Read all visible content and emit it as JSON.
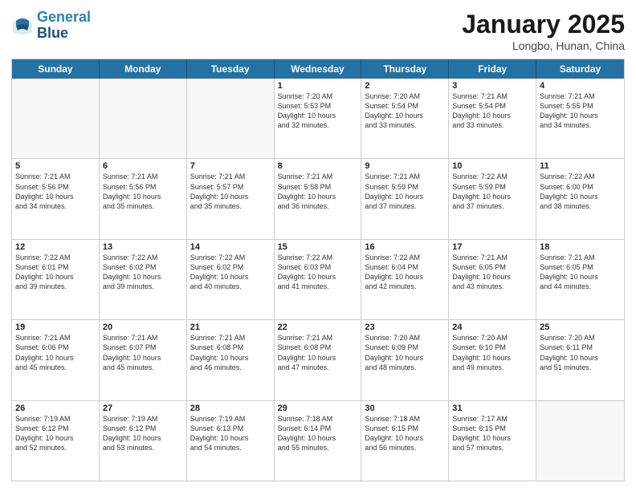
{
  "logo": {
    "line1": "General",
    "line2": "Blue"
  },
  "title": "January 2025",
  "subtitle": "Longbo, Hunan, China",
  "header_days": [
    "Sunday",
    "Monday",
    "Tuesday",
    "Wednesday",
    "Thursday",
    "Friday",
    "Saturday"
  ],
  "weeks": [
    [
      {
        "day": "",
        "info": ""
      },
      {
        "day": "",
        "info": ""
      },
      {
        "day": "",
        "info": ""
      },
      {
        "day": "1",
        "info": "Sunrise: 7:20 AM\nSunset: 5:53 PM\nDaylight: 10 hours\nand 32 minutes."
      },
      {
        "day": "2",
        "info": "Sunrise: 7:20 AM\nSunset: 5:54 PM\nDaylight: 10 hours\nand 33 minutes."
      },
      {
        "day": "3",
        "info": "Sunrise: 7:21 AM\nSunset: 5:54 PM\nDaylight: 10 hours\nand 33 minutes."
      },
      {
        "day": "4",
        "info": "Sunrise: 7:21 AM\nSunset: 5:55 PM\nDaylight: 10 hours\nand 34 minutes."
      }
    ],
    [
      {
        "day": "5",
        "info": "Sunrise: 7:21 AM\nSunset: 5:56 PM\nDaylight: 10 hours\nand 34 minutes."
      },
      {
        "day": "6",
        "info": "Sunrise: 7:21 AM\nSunset: 5:56 PM\nDaylight: 10 hours\nand 35 minutes."
      },
      {
        "day": "7",
        "info": "Sunrise: 7:21 AM\nSunset: 5:57 PM\nDaylight: 10 hours\nand 35 minutes."
      },
      {
        "day": "8",
        "info": "Sunrise: 7:21 AM\nSunset: 5:58 PM\nDaylight: 10 hours\nand 36 minutes."
      },
      {
        "day": "9",
        "info": "Sunrise: 7:21 AM\nSunset: 5:59 PM\nDaylight: 10 hours\nand 37 minutes."
      },
      {
        "day": "10",
        "info": "Sunrise: 7:22 AM\nSunset: 5:59 PM\nDaylight: 10 hours\nand 37 minutes."
      },
      {
        "day": "11",
        "info": "Sunrise: 7:22 AM\nSunset: 6:00 PM\nDaylight: 10 hours\nand 38 minutes."
      }
    ],
    [
      {
        "day": "12",
        "info": "Sunrise: 7:22 AM\nSunset: 6:01 PM\nDaylight: 10 hours\nand 39 minutes."
      },
      {
        "day": "13",
        "info": "Sunrise: 7:22 AM\nSunset: 6:02 PM\nDaylight: 10 hours\nand 39 minutes."
      },
      {
        "day": "14",
        "info": "Sunrise: 7:22 AM\nSunset: 6:02 PM\nDaylight: 10 hours\nand 40 minutes."
      },
      {
        "day": "15",
        "info": "Sunrise: 7:22 AM\nSunset: 6:03 PM\nDaylight: 10 hours\nand 41 minutes."
      },
      {
        "day": "16",
        "info": "Sunrise: 7:22 AM\nSunset: 6:04 PM\nDaylight: 10 hours\nand 42 minutes."
      },
      {
        "day": "17",
        "info": "Sunrise: 7:21 AM\nSunset: 6:05 PM\nDaylight: 10 hours\nand 43 minutes."
      },
      {
        "day": "18",
        "info": "Sunrise: 7:21 AM\nSunset: 6:05 PM\nDaylight: 10 hours\nand 44 minutes."
      }
    ],
    [
      {
        "day": "19",
        "info": "Sunrise: 7:21 AM\nSunset: 6:06 PM\nDaylight: 10 hours\nand 45 minutes."
      },
      {
        "day": "20",
        "info": "Sunrise: 7:21 AM\nSunset: 6:07 PM\nDaylight: 10 hours\nand 45 minutes."
      },
      {
        "day": "21",
        "info": "Sunrise: 7:21 AM\nSunset: 6:08 PM\nDaylight: 10 hours\nand 46 minutes."
      },
      {
        "day": "22",
        "info": "Sunrise: 7:21 AM\nSunset: 6:08 PM\nDaylight: 10 hours\nand 47 minutes."
      },
      {
        "day": "23",
        "info": "Sunrise: 7:20 AM\nSunset: 6:09 PM\nDaylight: 10 hours\nand 48 minutes."
      },
      {
        "day": "24",
        "info": "Sunrise: 7:20 AM\nSunset: 6:10 PM\nDaylight: 10 hours\nand 49 minutes."
      },
      {
        "day": "25",
        "info": "Sunrise: 7:20 AM\nSunset: 6:11 PM\nDaylight: 10 hours\nand 51 minutes."
      }
    ],
    [
      {
        "day": "26",
        "info": "Sunrise: 7:19 AM\nSunset: 6:12 PM\nDaylight: 10 hours\nand 52 minutes."
      },
      {
        "day": "27",
        "info": "Sunrise: 7:19 AM\nSunset: 6:12 PM\nDaylight: 10 hours\nand 53 minutes."
      },
      {
        "day": "28",
        "info": "Sunrise: 7:19 AM\nSunset: 6:13 PM\nDaylight: 10 hours\nand 54 minutes."
      },
      {
        "day": "29",
        "info": "Sunrise: 7:18 AM\nSunset: 6:14 PM\nDaylight: 10 hours\nand 55 minutes."
      },
      {
        "day": "30",
        "info": "Sunrise: 7:18 AM\nSunset: 6:15 PM\nDaylight: 10 hours\nand 56 minutes."
      },
      {
        "day": "31",
        "info": "Sunrise: 7:17 AM\nSunset: 6:15 PM\nDaylight: 10 hours\nand 57 minutes."
      },
      {
        "day": "",
        "info": ""
      }
    ]
  ]
}
